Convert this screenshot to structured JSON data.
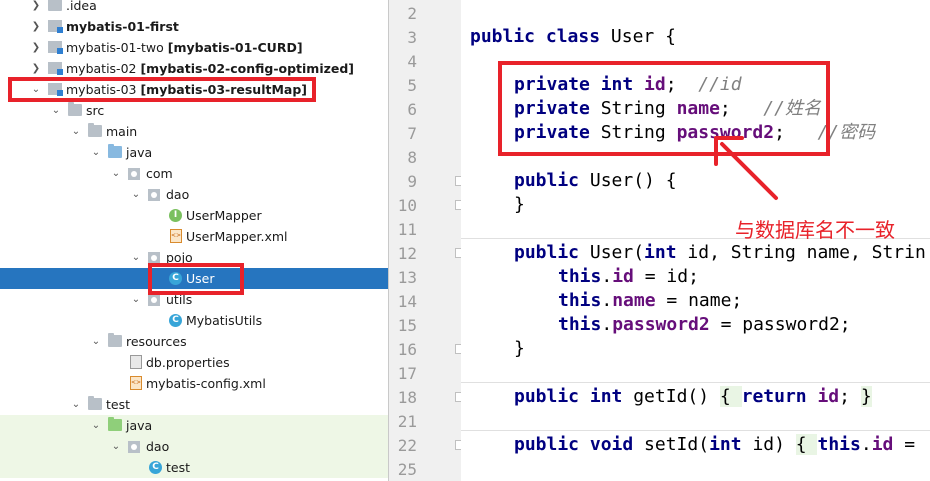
{
  "tree": {
    "items": [
      {
        "label": ".idea",
        "extra": "",
        "bold": false
      },
      {
        "label": "mybatis-01-first",
        "extra": "",
        "bold": true
      },
      {
        "label": "mybatis-01-two",
        "extra": "[mybatis-01-CURD]",
        "bold": false
      },
      {
        "label": "mybatis-02",
        "extra": "[mybatis-02-config-optimized]",
        "bold": false
      },
      {
        "label": "mybatis-03",
        "extra": "[mybatis-03-resultMap]",
        "bold": false
      },
      {
        "label": "src",
        "extra": "",
        "bold": false
      },
      {
        "label": "main",
        "extra": "",
        "bold": false
      },
      {
        "label": "java",
        "extra": "",
        "bold": false
      },
      {
        "label": "com",
        "extra": "",
        "bold": false
      },
      {
        "label": "dao",
        "extra": "",
        "bold": false
      },
      {
        "label": "UserMapper",
        "extra": "",
        "bold": false
      },
      {
        "label": "UserMapper.xml",
        "extra": "",
        "bold": false
      },
      {
        "label": "pojo",
        "extra": "",
        "bold": false
      },
      {
        "label": "User",
        "extra": "",
        "bold": false
      },
      {
        "label": "utils",
        "extra": "",
        "bold": false
      },
      {
        "label": "MybatisUtils",
        "extra": "",
        "bold": false
      },
      {
        "label": "resources",
        "extra": "",
        "bold": false
      },
      {
        "label": "db.properties",
        "extra": "",
        "bold": false
      },
      {
        "label": "mybatis-config.xml",
        "extra": "",
        "bold": false
      },
      {
        "label": "test",
        "extra": "",
        "bold": false
      },
      {
        "label": "java",
        "extra": "",
        "bold": false
      },
      {
        "label": "dao",
        "extra": "",
        "bold": false
      },
      {
        "label": "test",
        "extra": "",
        "bold": false
      }
    ]
  },
  "editor": {
    "line_numbers": [
      "2",
      "3",
      "4",
      "5",
      "6",
      "7",
      "8",
      "9",
      "10",
      "11",
      "12",
      "13",
      "14",
      "15",
      "16",
      "17",
      "18",
      "21",
      "22",
      "25"
    ],
    "lines": {
      "l3": [
        "public class ",
        "User {"
      ],
      "l5_kw": "private int ",
      "l5_f": "id",
      "l5_rest": ";  ",
      "l5_c": "//id",
      "l6_kw": "private ",
      "l6_t": "String ",
      "l6_f": "name",
      "l6_rest": ";   ",
      "l6_c": "//姓名",
      "l7_kw": "private ",
      "l7_t": "String ",
      "l7_f": "password2",
      "l7_rest": ";   ",
      "l7_c": "//密码",
      "l9_kw": "public ",
      "l9_rest": "User() {",
      "l10": "}",
      "l12_kw": "public ",
      "l12_rest1": "User(",
      "l12_kw2": "int ",
      "l12_rest2": "id, String name, Strin",
      "l13_kw": "this",
      "l13_dot": ".",
      "l13_f": "id",
      "l13_rest": " = id;",
      "l14_kw": "this",
      "l14_dot": ".",
      "l14_f": "name",
      "l14_rest": " = name;",
      "l15_kw": "this",
      "l15_dot": ".",
      "l15_f": "password2",
      "l15_rest": " = password2;",
      "l16": "}",
      "l18_kw": "public int ",
      "l18_m": "getId() ",
      "l18_b1": "{ ",
      "l18_kw2": "return ",
      "l18_f": "id",
      "l18_semi": "; ",
      "l18_b2": "}",
      "l22_kw": "public void ",
      "l22_m": "setId(",
      "l22_kw2": "int ",
      "l22_a": "id) ",
      "l22_b1": "{ ",
      "l22_kw3": "this",
      "l22_dot": ".",
      "l22_f": "id",
      "l22_rest": " ="
    }
  },
  "annotation": {
    "text": "与数据库名不一致",
    "color": "#e8222a"
  }
}
